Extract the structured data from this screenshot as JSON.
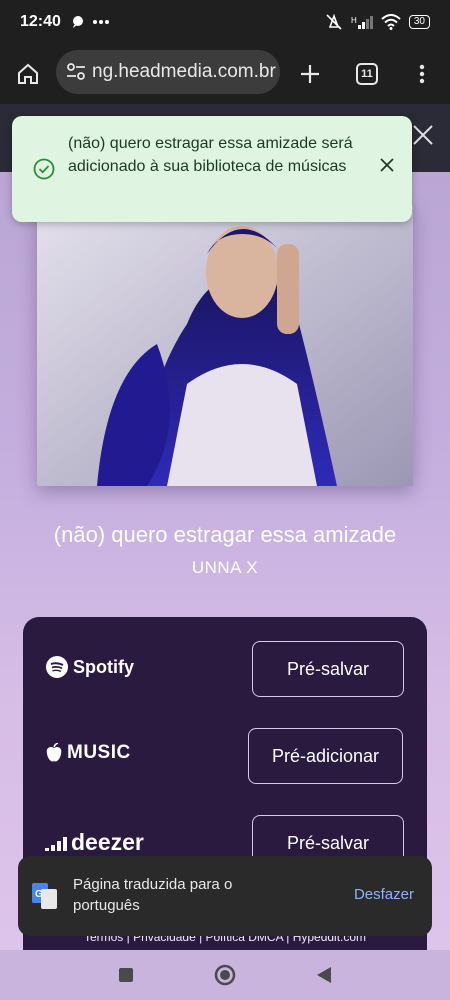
{
  "status_bar": {
    "time": "12:40",
    "battery": "30"
  },
  "browser": {
    "url": "ng.headmedia.com.br",
    "tab_count": "11"
  },
  "toast": {
    "message": "(não) quero estragar essa amizade será adicionado à sua biblioteca de músicas"
  },
  "release": {
    "title": "(não) quero estragar essa amizade",
    "artist": "UNNA X"
  },
  "services": [
    {
      "name": "Spotify",
      "button": "Pré-salvar"
    },
    {
      "name": "MUSIC",
      "button": "Pré-adicionar"
    },
    {
      "name": "deezer",
      "button": "Pré-salvar"
    }
  ],
  "footer": {
    "links": "Termos | Privacidade | Política DMCA | Hypeddit.com"
  },
  "translate_bar": {
    "message": "Página traduzida para o português",
    "undo_label": "Desfazer"
  },
  "colors": {
    "page_gradient_top": "#b8a4d2",
    "card_bg": "#2a1a40",
    "toast_bg": "#dff5e1",
    "toast_check": "#2e8b3e",
    "link_blue": "#8ab4f8"
  }
}
